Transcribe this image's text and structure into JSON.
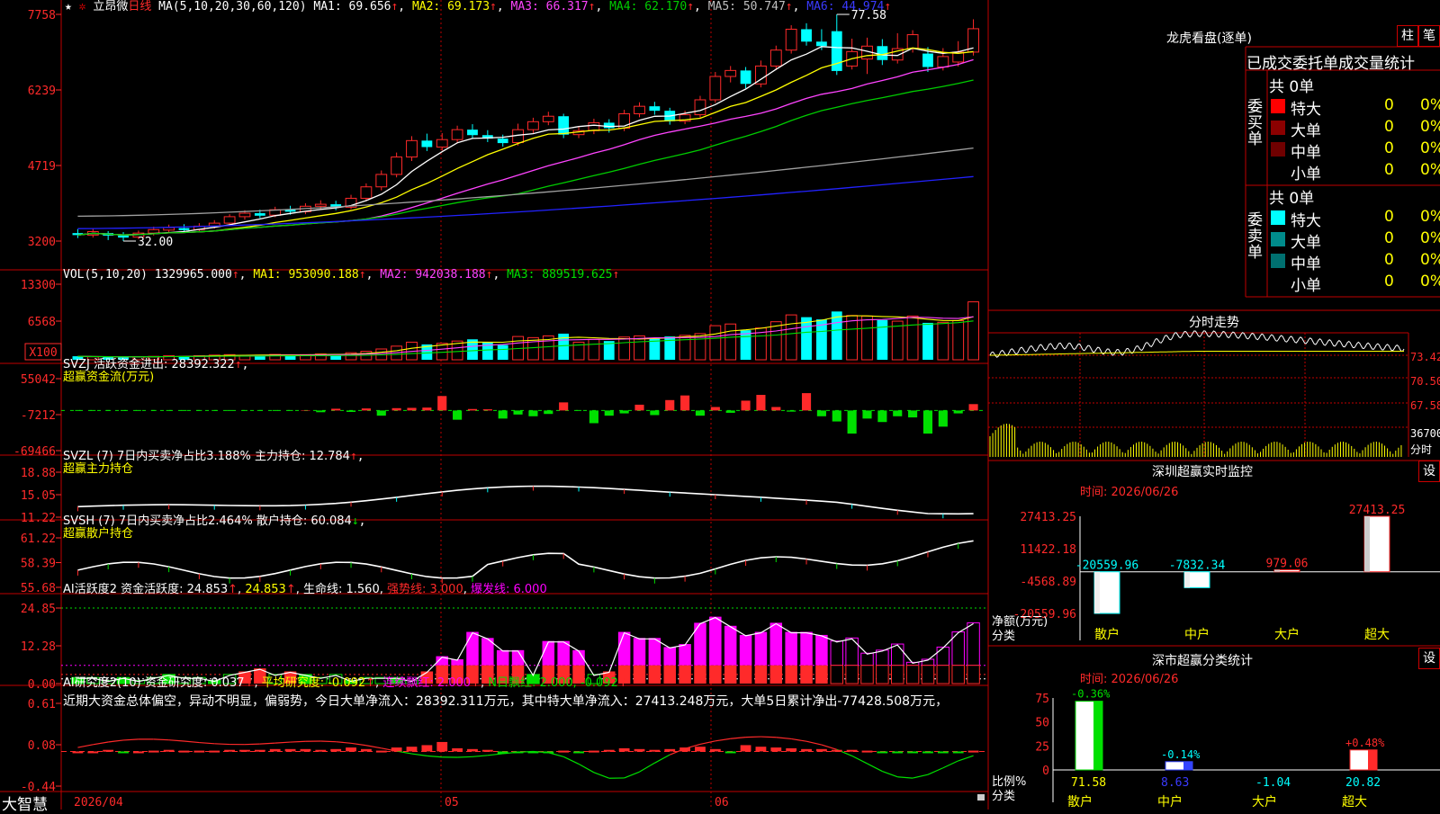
{
  "colors": {
    "up": "#ff2a2a",
    "down": "#00ffff",
    "green": "#00e000",
    "ma1": "#ffffff",
    "ma2": "#ffff00",
    "ma3": "#ff44ff",
    "ma4": "#00cc00",
    "ma5": "#a0a0a0",
    "ma6": "#2222ff",
    "grid": "#c00000",
    "magenta": "#ff00ff",
    "yellow": "#ffff00"
  },
  "header": {
    "stock_name": "立昂微",
    "period": "日线",
    "ma_spec": "MA(5,10,20,30,60,120)",
    "ma1": "MA1: 69.656",
    "ma2": "MA2: 69.173",
    "ma3": "MA3: 66.317",
    "ma4": "MA4: 62.170",
    "ma5": "MA5: 50.747",
    "ma6": "MA6: 44.974",
    "high_mark": "77.58",
    "low_mark": "32.00"
  },
  "price_axis": [
    "7758",
    "6239",
    "4719",
    "3200"
  ],
  "vol_panel": {
    "header": "VOL(5,10,20) 1329965.000",
    "ma1": "MA1: 953090.188",
    "ma2": "MA2: 942038.188",
    "ma3": "MA3: 889519.625",
    "axis": [
      "13300",
      "6568"
    ],
    "unit": "X100"
  },
  "svzj_panel": {
    "header": "SVZJ  活跃资金进出: 28392.322",
    "title": "超赢资金流(万元)",
    "axis": [
      "55042",
      "-7212",
      "-69466"
    ]
  },
  "svzl_panel": {
    "header": "SVZL (7) 7日内买卖净占比3.188% 主力持仓: 12.784",
    "title": "超赢主力持仓",
    "axis": [
      "18.88",
      "15.05",
      "11.22"
    ]
  },
  "svsh_panel": {
    "header": "SVSH (7) 7日内买卖净占比2.464% 散户持仓: 60.084",
    "title": "超赢散户持仓",
    "axis": [
      "61.22",
      "58.39",
      "55.68"
    ]
  },
  "ai_panel": {
    "header": "AI活跃度2 资金活跃度: 24.853",
    "v2": "24.853",
    "life": "生命线: 1.560",
    "strong": "强势线: 3.000",
    "burst": "爆发线: 6.000",
    "axis": [
      "24.85",
      "12.28",
      "0.00"
    ]
  },
  "ai2_panel": {
    "header": "AI研究度2(10) 资金研究度: 0.037",
    "avg": "平均研究度: -0.092",
    "lianxu": "连续飘红: 2.000",
    "nri": "N日飘红: 2.000, -0.092",
    "comment": "近期大资金总体偏空，异动不明显，偏弱势，今日大单净流入：28392.311万元，其中特大单净流入：27413.248万元，大单5日累计净出-77428.508万元，",
    "axis": [
      "0.61",
      "0.08",
      "-0.44"
    ]
  },
  "xaxis": {
    "labels": [
      "2026/04",
      "05",
      "06"
    ],
    "brand": "大智慧"
  },
  "lhb": {
    "title": "龙虎看盘(逐单)",
    "btn1": "柱",
    "btn2": "笔",
    "stats_title": "已成交委托单成交量统计",
    "buy": {
      "side": "委买单",
      "total": "共 0单",
      "rows": [
        {
          "name": "特大",
          "v": "0",
          "p": "0%"
        },
        {
          "name": "大单",
          "v": "0",
          "p": "0%"
        },
        {
          "name": "中单",
          "v": "0",
          "p": "0%"
        },
        {
          "name": "小单",
          "v": "0",
          "p": "0%"
        }
      ]
    },
    "sell": {
      "side": "委卖单",
      "total": "共 0单",
      "rows": [
        {
          "name": "特大",
          "v": "0",
          "p": "0%"
        },
        {
          "name": "大单",
          "v": "0",
          "p": "0%"
        },
        {
          "name": "中单",
          "v": "0",
          "p": "0%"
        },
        {
          "name": "小单",
          "v": "0",
          "p": "0%"
        }
      ]
    }
  },
  "minute": {
    "title": "分时走势",
    "axis": [
      "73.42",
      "70.50",
      "67.58",
      "36700",
      "分时"
    ]
  },
  "sz_monitor": {
    "title": "深圳超赢实时监控",
    "btn": "设",
    "time": "时间: 2026/06/26",
    "axis": [
      "27413.25",
      "11422.18",
      "-4568.89",
      "-20559.96"
    ],
    "net_label": "净额(万元)",
    "cls_label": "分类",
    "cats": [
      "散户",
      "中户",
      "大户",
      "超大"
    ],
    "values": [
      -20559.96,
      -7832.34,
      979.06,
      27413.25
    ],
    "value_labels": [
      "-20559.96",
      "-7832.34",
      "979.06",
      "27413.25"
    ]
  },
  "sz_stat": {
    "title": "深市超赢分类统计",
    "btn": "设",
    "time": "时间: 2026/06/26",
    "axis": [
      "75",
      "50",
      "25",
      "0"
    ],
    "ratio_label": "比例%",
    "cls_label": "分类",
    "cats": [
      "散户",
      "中户",
      "大户",
      "超大"
    ],
    "values": [
      71.58,
      8.63,
      -1.04,
      20.82
    ],
    "value_labels": [
      "71.58",
      "8.63",
      "-1.04",
      "20.82"
    ],
    "changes": [
      "-0.36%",
      "-0.14%",
      "",
      "+0.48%"
    ]
  },
  "chart_data": {
    "type": "candlestick",
    "title": "立昂微 日线",
    "price_range": [
      32.0,
      77.58
    ],
    "candles": [
      {
        "o": 33.6,
        "c": 33.2,
        "h": 34.4,
        "l": 32.6
      },
      {
        "o": 33.2,
        "c": 33.9,
        "h": 34.5,
        "l": 32.7
      },
      {
        "o": 33.6,
        "c": 33.1,
        "h": 34.0,
        "l": 32.2
      },
      {
        "o": 33.1,
        "c": 32.7,
        "h": 33.8,
        "l": 32.0
      },
      {
        "o": 32.8,
        "c": 33.6,
        "h": 34.1,
        "l": 32.4
      },
      {
        "o": 33.6,
        "c": 34.3,
        "h": 34.9,
        "l": 33.1
      },
      {
        "o": 34.2,
        "c": 34.7,
        "h": 35.3,
        "l": 33.7
      },
      {
        "o": 34.6,
        "c": 34.2,
        "h": 35.4,
        "l": 33.8
      },
      {
        "o": 34.3,
        "c": 35.0,
        "h": 35.6,
        "l": 33.9
      },
      {
        "o": 35.0,
        "c": 35.6,
        "h": 36.2,
        "l": 34.5
      },
      {
        "o": 35.6,
        "c": 36.9,
        "h": 37.4,
        "l": 35.1
      },
      {
        "o": 36.9,
        "c": 37.6,
        "h": 38.2,
        "l": 36.3
      },
      {
        "o": 37.6,
        "c": 37.1,
        "h": 38.3,
        "l": 36.6
      },
      {
        "o": 37.2,
        "c": 38.3,
        "h": 38.9,
        "l": 36.8
      },
      {
        "o": 38.3,
        "c": 37.9,
        "h": 39.1,
        "l": 37.3
      },
      {
        "o": 37.9,
        "c": 39.0,
        "h": 39.6,
        "l": 37.4
      },
      {
        "o": 39.0,
        "c": 39.4,
        "h": 40.2,
        "l": 38.3
      },
      {
        "o": 39.4,
        "c": 38.8,
        "h": 40.1,
        "l": 38.2
      },
      {
        "o": 38.8,
        "c": 40.6,
        "h": 41.3,
        "l": 38.4
      },
      {
        "o": 40.6,
        "c": 42.9,
        "h": 43.6,
        "l": 40.0
      },
      {
        "o": 42.9,
        "c": 45.4,
        "h": 46.2,
        "l": 42.2
      },
      {
        "o": 45.4,
        "c": 48.9,
        "h": 49.8,
        "l": 44.8
      },
      {
        "o": 48.9,
        "c": 52.2,
        "h": 53.1,
        "l": 48.1
      },
      {
        "o": 52.2,
        "c": 50.9,
        "h": 53.6,
        "l": 50.1
      },
      {
        "o": 50.9,
        "c": 52.4,
        "h": 53.7,
        "l": 50.2
      },
      {
        "o": 52.4,
        "c": 54.4,
        "h": 55.2,
        "l": 51.7
      },
      {
        "o": 54.4,
        "c": 53.3,
        "h": 55.5,
        "l": 52.6
      },
      {
        "o": 53.3,
        "c": 52.6,
        "h": 54.3,
        "l": 51.9
      },
      {
        "o": 52.6,
        "c": 51.7,
        "h": 53.4,
        "l": 51.0
      },
      {
        "o": 51.8,
        "c": 54.4,
        "h": 55.6,
        "l": 51.2
      },
      {
        "o": 54.4,
        "c": 56.0,
        "h": 56.8,
        "l": 53.7
      },
      {
        "o": 56.0,
        "c": 57.1,
        "h": 58.0,
        "l": 55.3
      },
      {
        "o": 57.1,
        "c": 53.4,
        "h": 57.6,
        "l": 52.7
      },
      {
        "o": 53.4,
        "c": 54.2,
        "h": 55.1,
        "l": 52.7
      },
      {
        "o": 54.2,
        "c": 55.8,
        "h": 56.6,
        "l": 53.5
      },
      {
        "o": 55.8,
        "c": 54.7,
        "h": 56.5,
        "l": 53.8
      },
      {
        "o": 54.7,
        "c": 57.6,
        "h": 58.4,
        "l": 54.1
      },
      {
        "o": 57.6,
        "c": 59.1,
        "h": 59.9,
        "l": 56.9
      },
      {
        "o": 59.1,
        "c": 58.2,
        "h": 60.0,
        "l": 57.4
      },
      {
        "o": 58.2,
        "c": 56.1,
        "h": 58.8,
        "l": 55.4
      },
      {
        "o": 56.1,
        "c": 57.4,
        "h": 58.2,
        "l": 55.5
      },
      {
        "o": 57.4,
        "c": 60.4,
        "h": 61.2,
        "l": 56.8
      },
      {
        "o": 60.4,
        "c": 65.1,
        "h": 66.0,
        "l": 59.8
      },
      {
        "o": 65.1,
        "c": 66.3,
        "h": 67.2,
        "l": 63.9
      },
      {
        "o": 66.3,
        "c": 63.6,
        "h": 67.0,
        "l": 62.7
      },
      {
        "o": 63.6,
        "c": 67.2,
        "h": 68.3,
        "l": 62.9
      },
      {
        "o": 67.2,
        "c": 70.4,
        "h": 71.3,
        "l": 66.4
      },
      {
        "o": 70.4,
        "c": 74.6,
        "h": 75.4,
        "l": 69.7
      },
      {
        "o": 74.6,
        "c": 72.1,
        "h": 75.8,
        "l": 71.3
      },
      {
        "o": 72.1,
        "c": 71.2,
        "h": 74.6,
        "l": 70.4
      },
      {
        "o": 74.2,
        "c": 66.2,
        "h": 77.58,
        "l": 65.4
      },
      {
        "o": 67.2,
        "c": 70.1,
        "h": 72.7,
        "l": 66.5
      },
      {
        "o": 68.6,
        "c": 71.2,
        "h": 72.9,
        "l": 65.6
      },
      {
        "o": 71.2,
        "c": 68.4,
        "h": 72.6,
        "l": 67.4
      },
      {
        "o": 68.4,
        "c": 70.7,
        "h": 73.8,
        "l": 67.7
      },
      {
        "o": 70.7,
        "c": 73.5,
        "h": 74.4,
        "l": 69.9
      },
      {
        "o": 69.7,
        "c": 67.0,
        "h": 71.0,
        "l": 66.0
      },
      {
        "o": 67.0,
        "c": 69.1,
        "h": 70.8,
        "l": 66.3
      },
      {
        "o": 68.0,
        "c": 70.0,
        "h": 72.2,
        "l": 67.1
      },
      {
        "o": 70.0,
        "c": 74.7,
        "h": 76.6,
        "l": 69.3
      }
    ],
    "volume_range": [
      0,
      13300
    ],
    "svzj_range": [
      -69466,
      55042
    ],
    "svzl_range": [
      11.22,
      18.88
    ],
    "svsh_range": [
      55.68,
      61.22
    ],
    "ai_range": [
      0,
      24.85
    ],
    "ai2_range": [
      -0.44,
      0.61
    ]
  }
}
